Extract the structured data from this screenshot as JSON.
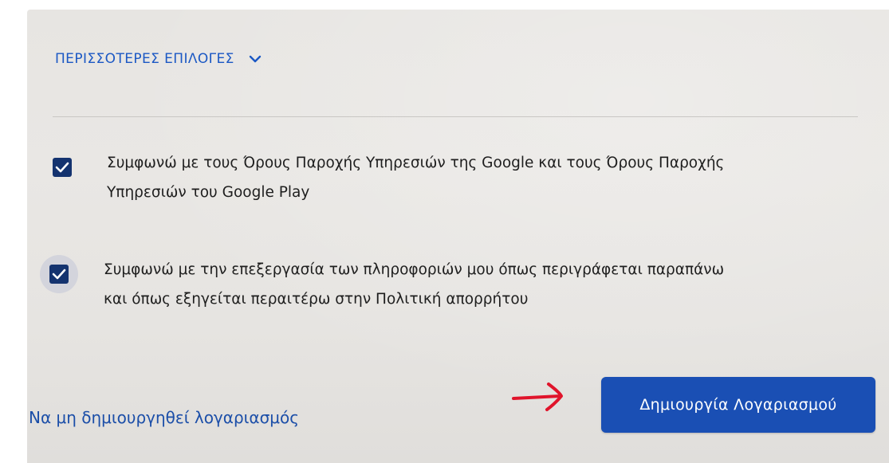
{
  "more_options": {
    "label": "ΠΕΡΙΣΣΟΤΕΡΕΣ ΕΠΙΛΟΓΕΣ",
    "icon": "chevron-down-icon"
  },
  "consents": [
    {
      "checked": true,
      "line1": "Συμφωνώ με τους Όρους Παροχής Υπηρεσιών της Google και τους Όρους Παροχής",
      "line2": "Υπηρεσιών του Google Play"
    },
    {
      "checked": true,
      "line1": "Συμφωνώ με την επεξεργασία των πληροφοριών μου όπως περιγράφεται παραπάνω",
      "line2": "και όπως εξηγείται περαιτέρω στην Πολιτική απορρήτου"
    }
  ],
  "actions": {
    "skip_label": "Να μη δημιουργηθεί λογαριασμός",
    "create_label": "Δημιουργία Λογαριασμού"
  },
  "annotation": {
    "icon": "arrow-right-icon",
    "color": "#e0142b"
  },
  "colors": {
    "accent": "#1a4fb4",
    "checkbox": "#14336f",
    "background": "#e8e6e3"
  }
}
